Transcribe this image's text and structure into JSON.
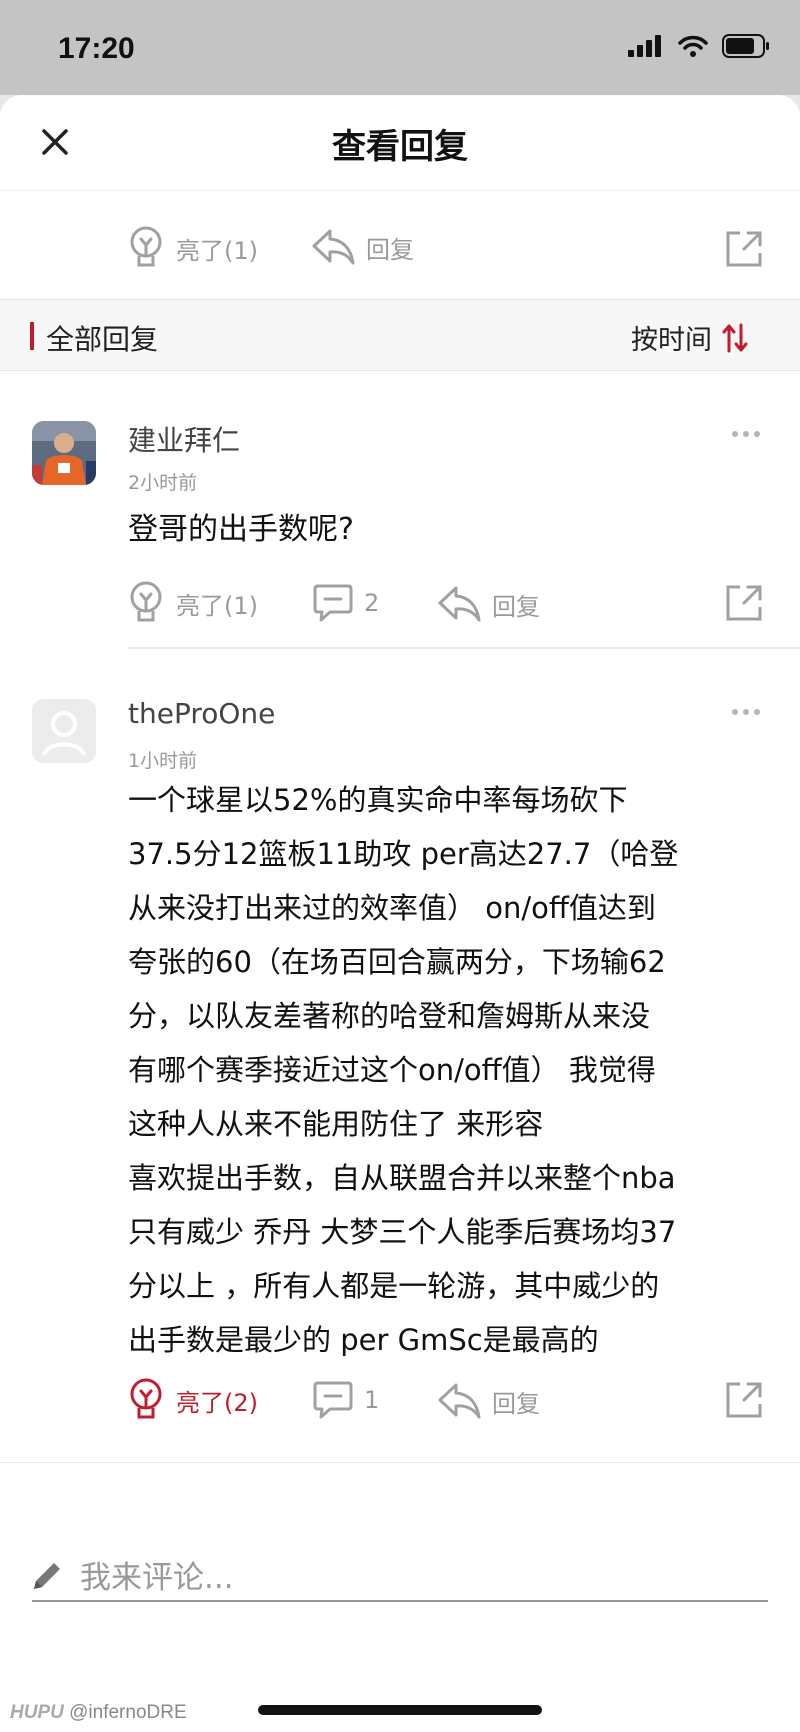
{
  "status": {
    "time": "17:20"
  },
  "header": {
    "title": "查看回复"
  },
  "top_actions": {
    "like_label": "亮了(1)",
    "reply_label": "回复"
  },
  "section": {
    "title": "全部回复",
    "sort_label": "按时间"
  },
  "comments": [
    {
      "username": "建业拜仁",
      "time": "2小时前",
      "lines": [
        "登哥的出手数呢?"
      ],
      "like_label": "亮了(1)",
      "reply_count": "2",
      "reply_label": "回复",
      "liked": false
    },
    {
      "username": "theProOne",
      "time": "1小时前",
      "lines": [
        "一个球星以52%的真实命中率每场砍下",
        "37.5分12篮板11助攻 per高达27.7（哈登",
        "从来没打出来过的效率值） on/off值达到",
        "夸张的60（在场百回合赢两分，下场输62",
        "分，以队友差著称的哈登和詹姆斯从来没",
        "有哪个赛季接近过这个on/off值） 我觉得",
        "这种人从来不能用防住了 来形容",
        "喜欢提出手数，自从联盟合并以来整个nba",
        "只有威少 乔丹 大梦三个人能季后赛场均37",
        "分以上 ，所有人都是一轮游，其中威少的",
        "出手数是最少的 per GmSc是最高的"
      ],
      "like_label": "亮了(2)",
      "reply_count": "1",
      "reply_label": "回复",
      "liked": true
    }
  ],
  "input": {
    "placeholder": "我来评论..."
  },
  "watermark": {
    "brand": "HUPU",
    "handle": "@infernoDRE"
  },
  "colors": {
    "accent": "#c01e2f",
    "icon_gray": "#a0a0a0"
  }
}
